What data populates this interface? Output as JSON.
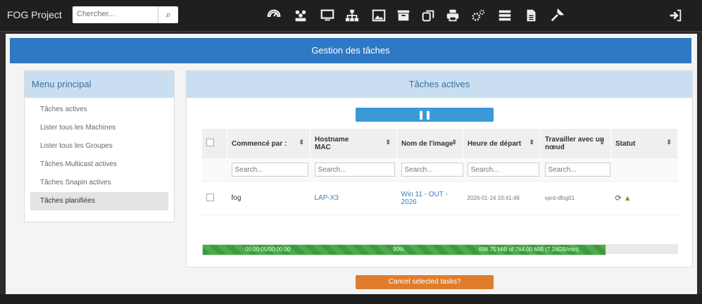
{
  "brand": "FOG Project",
  "search": {
    "placeholder": "Chercher..."
  },
  "nav_icons": [
    "dashboard-icon",
    "users-icon",
    "computer-icon",
    "sitemap-icon",
    "image-icon",
    "archive-icon",
    "copy-icon",
    "printer-icon",
    "settings-icon",
    "server-icon",
    "document-icon",
    "wrench-icon",
    "logout-icon"
  ],
  "page_title": "Gestion des tâches",
  "left_menu": {
    "header": "Menu principal",
    "items": [
      {
        "label": "Tâches actives"
      },
      {
        "label": "Lister tous les Machines"
      },
      {
        "label": "Lister tous les Groupes"
      },
      {
        "label": "Tâches Multicast actives"
      },
      {
        "label": "Tâches Snapin actives"
      },
      {
        "label": "Tâches planifiées"
      }
    ]
  },
  "active_tasks": {
    "header": "Tâches actives",
    "pause_icon": "pause-icon",
    "columns": [
      {
        "label": "Commencé par :",
        "sub": ""
      },
      {
        "label": "Hostname",
        "sub": "MAC"
      },
      {
        "label": "Nom de l'image",
        "sub": ""
      },
      {
        "label": "Heure de départ",
        "sub": ""
      },
      {
        "label": "Travailler avec un nœud",
        "sub": ""
      },
      {
        "label": "Statut",
        "sub": ""
      }
    ],
    "filter_placeholder": "Search...",
    "rows": [
      {
        "started_by": "fog",
        "hostname": "LAP-X3",
        "image": "Win 11 - OUT - 2026",
        "start_time": "2026-01-16 10:41:48",
        "node": "vprd-dfog01",
        "status_icons": [
          "refresh-icon",
          "download-icon"
        ]
      }
    ],
    "progress": {
      "percent": 90,
      "elapsed": "00:00:05/00:00:00",
      "label": "90%",
      "transfer": "696.75 MiB of 764.00 MiB (7.24GB/min)"
    },
    "cancel_label": "Cancel selected tasks?"
  }
}
